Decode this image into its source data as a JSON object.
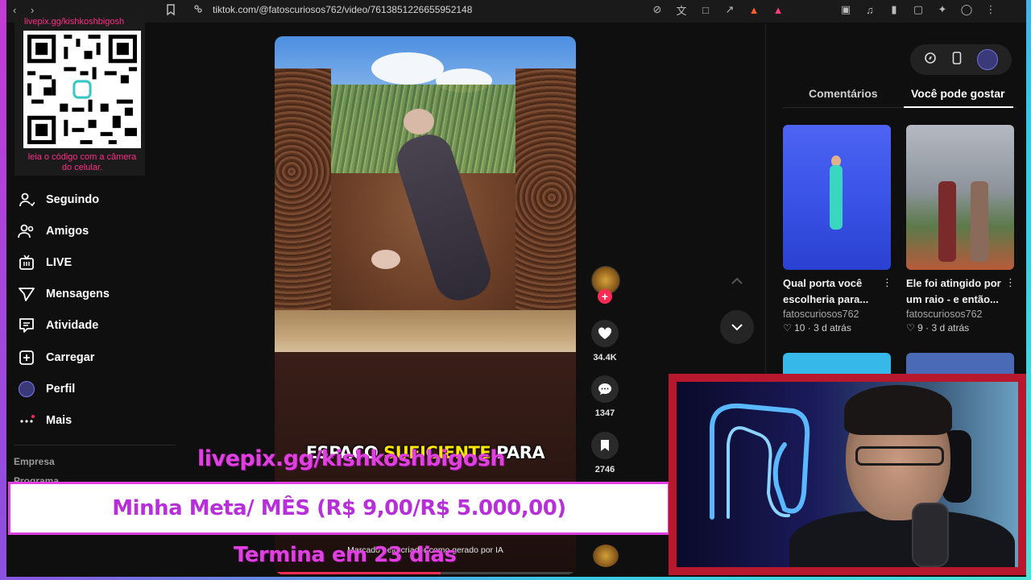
{
  "browser": {
    "url": "tiktok.com/@fatoscuriosos762/video/7613851226655952148"
  },
  "overlay": {
    "qr_handle": "livepix.gg/kishkoshbigosh",
    "qr_caption": "leia o código com a câmera do celular.",
    "livepix_url": "livepix.gg/kishkoshbigosh",
    "goal_text": "Minha Meta/ MÊS (R$ 9,00/R$ 5.000,00)",
    "ends_text": "Termina em 23 dias"
  },
  "sidebar": {
    "items": [
      {
        "label": "Seguindo",
        "icon": "person-follow-icon"
      },
      {
        "label": "Amigos",
        "icon": "friends-icon"
      },
      {
        "label": "LIVE",
        "icon": "live-tv-icon"
      },
      {
        "label": "Mensagens",
        "icon": "send-icon"
      },
      {
        "label": "Atividade",
        "icon": "activity-icon"
      },
      {
        "label": "Carregar",
        "icon": "upload-plus-icon"
      },
      {
        "label": "Perfil",
        "icon": "avatar"
      },
      {
        "label": "Mais",
        "icon": "more-dots-icon"
      }
    ],
    "footer": {
      "empresa": "Empresa",
      "programa": "Programa"
    }
  },
  "video": {
    "caption_pre": "ESPAÇO ",
    "caption_hl": "SUFICIENTE",
    "caption_post": " PARA",
    "ai_note": "Marcado pelo criador como gerado por IA",
    "progress": 0.55
  },
  "actions": {
    "likes": "34.4K",
    "comments": "1347",
    "saves": "2746"
  },
  "right_panel": {
    "tabs": {
      "comments": "Comentários",
      "suggested": "Você pode gostar"
    },
    "cards": [
      {
        "title": "Qual porta você escolheria para...",
        "author": "fatoscuriosos762",
        "likes": "10",
        "age": "3 d atrás"
      },
      {
        "title": "Ele foi atingido por um raio - e então...",
        "author": "fatoscuriosos762",
        "likes": "9",
        "age": "3 d atrás"
      }
    ]
  },
  "colors": {
    "accent": "#fe2c55",
    "overlay_pink": "#e040e0",
    "highlight_yellow": "#ffe600",
    "webcam_frame": "#b8182e"
  }
}
